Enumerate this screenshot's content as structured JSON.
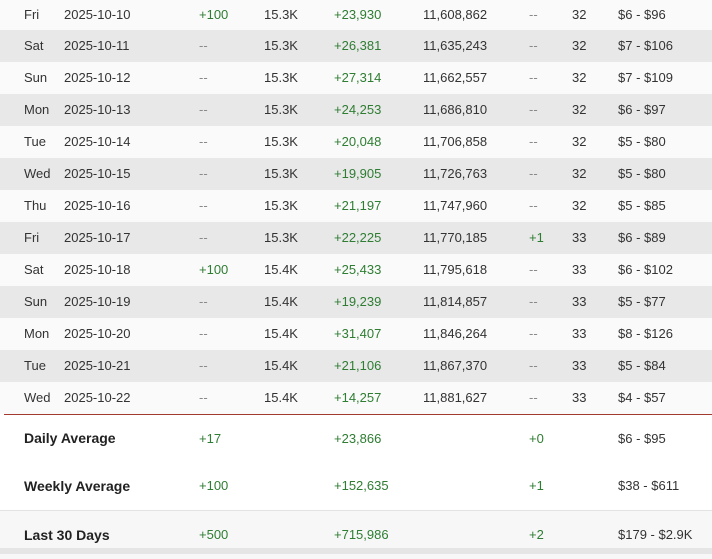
{
  "rows": [
    {
      "day": "Fri",
      "date": "2025-10-10",
      "followers_gain": "+100",
      "followers": "15.3K",
      "views_gain": "+23,930",
      "views": "11,608,862",
      "rank_gain": "--",
      "rank": "32",
      "earnings": "$6 - $96"
    },
    {
      "day": "Sat",
      "date": "2025-10-11",
      "followers_gain": "--",
      "followers": "15.3K",
      "views_gain": "+26,381",
      "views": "11,635,243",
      "rank_gain": "--",
      "rank": "32",
      "earnings": "$7 - $106"
    },
    {
      "day": "Sun",
      "date": "2025-10-12",
      "followers_gain": "--",
      "followers": "15.3K",
      "views_gain": "+27,314",
      "views": "11,662,557",
      "rank_gain": "--",
      "rank": "32",
      "earnings": "$7 - $109"
    },
    {
      "day": "Mon",
      "date": "2025-10-13",
      "followers_gain": "--",
      "followers": "15.3K",
      "views_gain": "+24,253",
      "views": "11,686,810",
      "rank_gain": "--",
      "rank": "32",
      "earnings": "$6 - $97"
    },
    {
      "day": "Tue",
      "date": "2025-10-14",
      "followers_gain": "--",
      "followers": "15.3K",
      "views_gain": "+20,048",
      "views": "11,706,858",
      "rank_gain": "--",
      "rank": "32",
      "earnings": "$5 - $80"
    },
    {
      "day": "Wed",
      "date": "2025-10-15",
      "followers_gain": "--",
      "followers": "15.3K",
      "views_gain": "+19,905",
      "views": "11,726,763",
      "rank_gain": "--",
      "rank": "32",
      "earnings": "$5 - $80"
    },
    {
      "day": "Thu",
      "date": "2025-10-16",
      "followers_gain": "--",
      "followers": "15.3K",
      "views_gain": "+21,197",
      "views": "11,747,960",
      "rank_gain": "--",
      "rank": "32",
      "earnings": "$5 - $85"
    },
    {
      "day": "Fri",
      "date": "2025-10-17",
      "followers_gain": "--",
      "followers": "15.3K",
      "views_gain": "+22,225",
      "views": "11,770,185",
      "rank_gain": "+1",
      "rank": "33",
      "earnings": "$6 - $89"
    },
    {
      "day": "Sat",
      "date": "2025-10-18",
      "followers_gain": "+100",
      "followers": "15.4K",
      "views_gain": "+25,433",
      "views": "11,795,618",
      "rank_gain": "--",
      "rank": "33",
      "earnings": "$6 - $102"
    },
    {
      "day": "Sun",
      "date": "2025-10-19",
      "followers_gain": "--",
      "followers": "15.4K",
      "views_gain": "+19,239",
      "views": "11,814,857",
      "rank_gain": "--",
      "rank": "33",
      "earnings": "$5 - $77"
    },
    {
      "day": "Mon",
      "date": "2025-10-20",
      "followers_gain": "--",
      "followers": "15.4K",
      "views_gain": "+31,407",
      "views": "11,846,264",
      "rank_gain": "--",
      "rank": "33",
      "earnings": "$8 - $126"
    },
    {
      "day": "Tue",
      "date": "2025-10-21",
      "followers_gain": "--",
      "followers": "15.4K",
      "views_gain": "+21,106",
      "views": "11,867,370",
      "rank_gain": "--",
      "rank": "33",
      "earnings": "$5 - $84"
    },
    {
      "day": "Wed",
      "date": "2025-10-22",
      "followers_gain": "--",
      "followers": "15.4K",
      "views_gain": "+14,257",
      "views": "11,881,627",
      "rank_gain": "--",
      "rank": "33",
      "earnings": "$4 - $57"
    }
  ],
  "summary": {
    "daily": {
      "label": "Daily Average",
      "followers_gain": "+17",
      "views_gain": "+23,866",
      "rank_gain": "+0",
      "earnings": "$6 - $95"
    },
    "weekly": {
      "label": "Weekly Average",
      "followers_gain": "+100",
      "views_gain": "+152,635",
      "rank_gain": "+1",
      "earnings": "$38 - $611"
    },
    "last30": {
      "label": "Last 30 Days",
      "followers_gain": "+500",
      "views_gain": "+715,986",
      "rank_gain": "+2",
      "earnings": "$179 - $2.9K"
    }
  },
  "colors": {
    "gain": "#2e7d32",
    "divider": "#a33a2f",
    "row_odd": "#fafafa",
    "row_even": "#e8e8e8"
  }
}
